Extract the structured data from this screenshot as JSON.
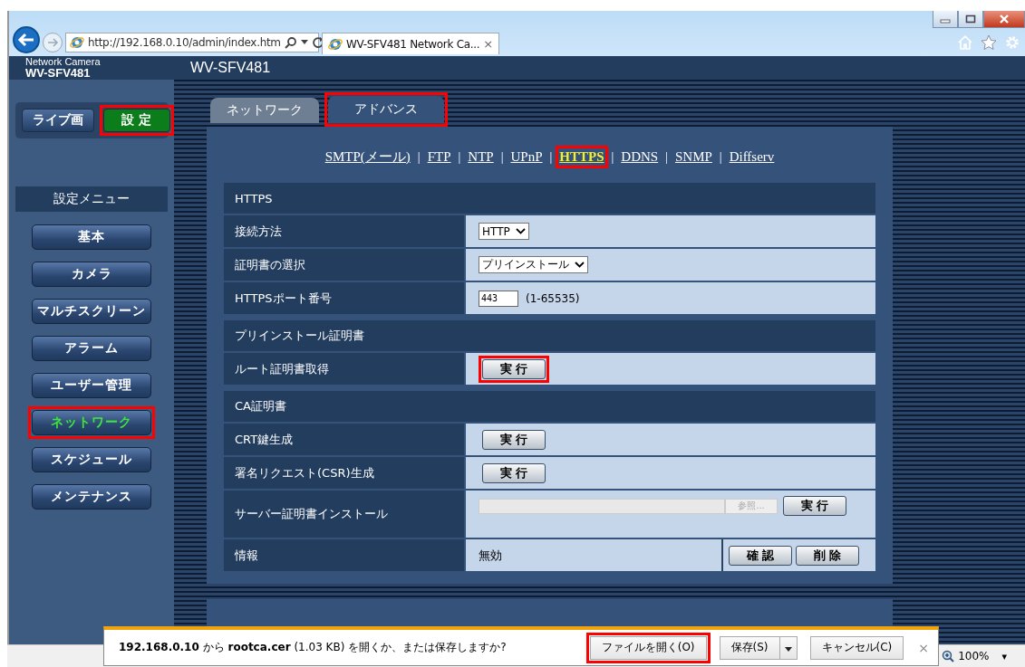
{
  "browser": {
    "address": "http://192.168.0.10/admin/index.htm",
    "tab_title": "WV-SFV481 Network Ca...",
    "tab_close": "×",
    "zoom": "100%",
    "zoom_caret": "▾"
  },
  "header": {
    "brand": "Network Camera",
    "model": "WV-SFV481",
    "title": "WV-SFV481"
  },
  "mode_buttons": [
    {
      "label": "ライブ画",
      "selected": false,
      "highlighted": false
    },
    {
      "label": "設 定",
      "selected": true,
      "highlighted": true
    }
  ],
  "menu": {
    "title": "設定メニュー",
    "items": [
      {
        "label": "基本",
        "selected": false,
        "highlighted": false
      },
      {
        "label": "カメラ",
        "selected": false,
        "highlighted": false
      },
      {
        "label": "マルチスクリーン",
        "selected": false,
        "highlighted": false
      },
      {
        "label": "アラーム",
        "selected": false,
        "highlighted": false
      },
      {
        "label": "ユーザー管理",
        "selected": false,
        "highlighted": false
      },
      {
        "label": "ネットワーク",
        "selected": true,
        "highlighted": true
      },
      {
        "label": "スケジュール",
        "selected": false,
        "highlighted": false
      },
      {
        "label": "メンテナンス",
        "selected": false,
        "highlighted": false
      }
    ]
  },
  "tabs": [
    {
      "label": "ネットワーク",
      "selected": false,
      "highlighted": false
    },
    {
      "label": "アドバンス",
      "selected": true,
      "highlighted": true
    }
  ],
  "links": [
    {
      "label": "SMTP(メール)",
      "selected": false,
      "highlighted": false
    },
    {
      "label": "FTP",
      "selected": false,
      "highlighted": false
    },
    {
      "label": "NTP",
      "selected": false,
      "highlighted": false
    },
    {
      "label": "UPnP",
      "selected": false,
      "highlighted": false
    },
    {
      "label": "HTTPS",
      "selected": true,
      "highlighted": true
    },
    {
      "label": "DDNS",
      "selected": false,
      "highlighted": false
    },
    {
      "label": "SNMP",
      "selected": false,
      "highlighted": false
    },
    {
      "label": "Diffserv",
      "selected": false,
      "highlighted": false
    }
  ],
  "link_separator": "|",
  "sections": [
    {
      "title": "HTTPS",
      "rows": [
        {
          "kind": "select",
          "label": "接続方法",
          "value": "HTTP"
        },
        {
          "kind": "select",
          "label": "証明書の選択",
          "value": "プリインストール"
        },
        {
          "kind": "number",
          "label": "HTTPSポート番号",
          "value": "443",
          "note": "(1-65535)"
        }
      ]
    },
    {
      "title": "プリインストール証明書",
      "rows": [
        {
          "kind": "button",
          "label": "ルート証明書取得",
          "button": "実 行",
          "highlighted": true
        }
      ]
    },
    {
      "title": "CA証明書",
      "rows": [
        {
          "kind": "button",
          "label": "CRT鍵生成",
          "button": "実 行",
          "highlighted": false
        },
        {
          "kind": "button",
          "label": "署名リクエスト(CSR)生成",
          "button": "実 行",
          "highlighted": false
        },
        {
          "kind": "file",
          "label": "サーバー証明書インストール",
          "browse": "参照...",
          "disabled": true,
          "button": "実 行"
        },
        {
          "kind": "info",
          "label": "情報",
          "value": "無効",
          "buttons": [
            "確 認",
            "削 除"
          ]
        }
      ]
    }
  ],
  "download_bar": {
    "message": "**192.168.0.10** から **rootca.cer** (1.03 KB) を開くか、または保存しますか?",
    "buttons": [
      {
        "kind": "plain",
        "label": "ファイルを開く(O)",
        "highlighted": true
      },
      {
        "kind": "split",
        "label": "保存(S)",
        "highlighted": false
      },
      {
        "kind": "plain",
        "label": "キャンセル(C)",
        "highlighted": false
      }
    ],
    "close": "×"
  }
}
